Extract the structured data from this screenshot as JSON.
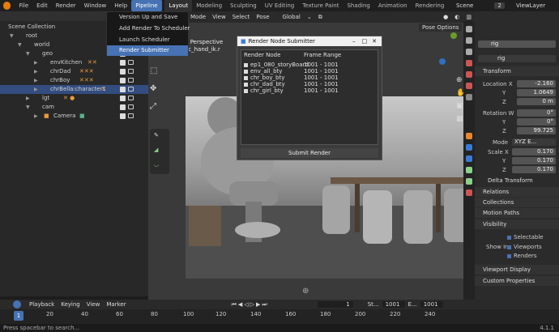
{
  "menubar": {
    "items": [
      "File",
      "Edit",
      "Render",
      "Window",
      "Help",
      "Pipeline"
    ],
    "active": "Pipeline"
  },
  "workspaces": {
    "tabs": [
      "Layout",
      "Modeling",
      "Sculpting",
      "UV Editing",
      "Texture Paint",
      "Shading",
      "Animation",
      "Rendering"
    ],
    "active": "Layout"
  },
  "topright": {
    "scene": "Scene",
    "scene_num": "2",
    "view_layer": "ViewLayer"
  },
  "pipeline_menu": {
    "items": [
      "Version Up and Save",
      "Add Render To Scheduler",
      "Launch Scheduler",
      "Render Submitter"
    ],
    "highlighted": "Render Submitter"
  },
  "outliner": {
    "header": "Scene Collection",
    "rows": [
      {
        "label": "root"
      },
      {
        "label": "world"
      },
      {
        "label": "geo"
      },
      {
        "label": "envKitchen"
      },
      {
        "label": "chrDad"
      },
      {
        "label": "chrBoy"
      },
      {
        "label": "chrBella:character1"
      },
      {
        "label": "lgt"
      },
      {
        "label": "cam"
      },
      {
        "label": "Camera"
      }
    ]
  },
  "viewport": {
    "mode": "Mode",
    "menus": [
      "View",
      "Select",
      "Pose"
    ],
    "transform": "Global",
    "pose_options": "Pose Options",
    "overlay_title": "era Perspective",
    "overlay_sub": "g : c_hand_ik.r"
  },
  "dialog": {
    "title": "Render Node Submitter",
    "col_node": "Render Node",
    "col_range": "Frame Range",
    "rows": [
      {
        "node": "ep1_080_storyBoard",
        "range": "1001 - 1001"
      },
      {
        "node": "env_all_bty",
        "range": "1001 - 1001"
      },
      {
        "node": "chr_boy_bty",
        "range": "1001 - 1001"
      },
      {
        "node": "chr_dad_bty",
        "range": "1001 - 1001"
      },
      {
        "node": "chr_girl_bty",
        "range": "1001 - 1001"
      }
    ],
    "submit": "Submit Render"
  },
  "properties": {
    "object_name": "rig",
    "data_name": "rig",
    "transform_panel": "Transform",
    "location_label": "Location",
    "location": [
      "-2.160",
      "1.0649",
      "0 m"
    ],
    "rotation_label": "Rotation",
    "rotation": [
      "0°",
      "0°",
      "99.725"
    ],
    "mode_label": "Mode",
    "mode_value": "XYZ E...",
    "scale_label": "Scale X",
    "scale": [
      "0.170",
      "0.170",
      "0.170"
    ],
    "axis_y": "Y",
    "axis_z": "Z",
    "delta": "Delta Transform",
    "relations": "Relations",
    "collections": "Collections",
    "motion_paths": "Motion Paths",
    "visibility": "Visibility",
    "selectable": "Selectable",
    "show_in": "Show In",
    "viewports": "Viewports",
    "renders": "Renders",
    "viewport_display": "Viewport Display",
    "custom_props": "Custom Properties"
  },
  "timeline": {
    "menus": [
      "Playback",
      "Keying",
      "View",
      "Marker"
    ],
    "current_frame": "1",
    "start_label": "St...",
    "start": "1001",
    "end_label": "E...",
    "end": "1001",
    "ticks": [
      "1",
      "20",
      "40",
      "60",
      "80",
      "100",
      "120",
      "140",
      "160",
      "180",
      "200",
      "220",
      "240"
    ]
  },
  "status": {
    "hint": "Press spacebar to search...",
    "version": "4.1.1"
  },
  "colors": {
    "accent": "#4772b3",
    "blender_orange": "#e87d0d"
  }
}
